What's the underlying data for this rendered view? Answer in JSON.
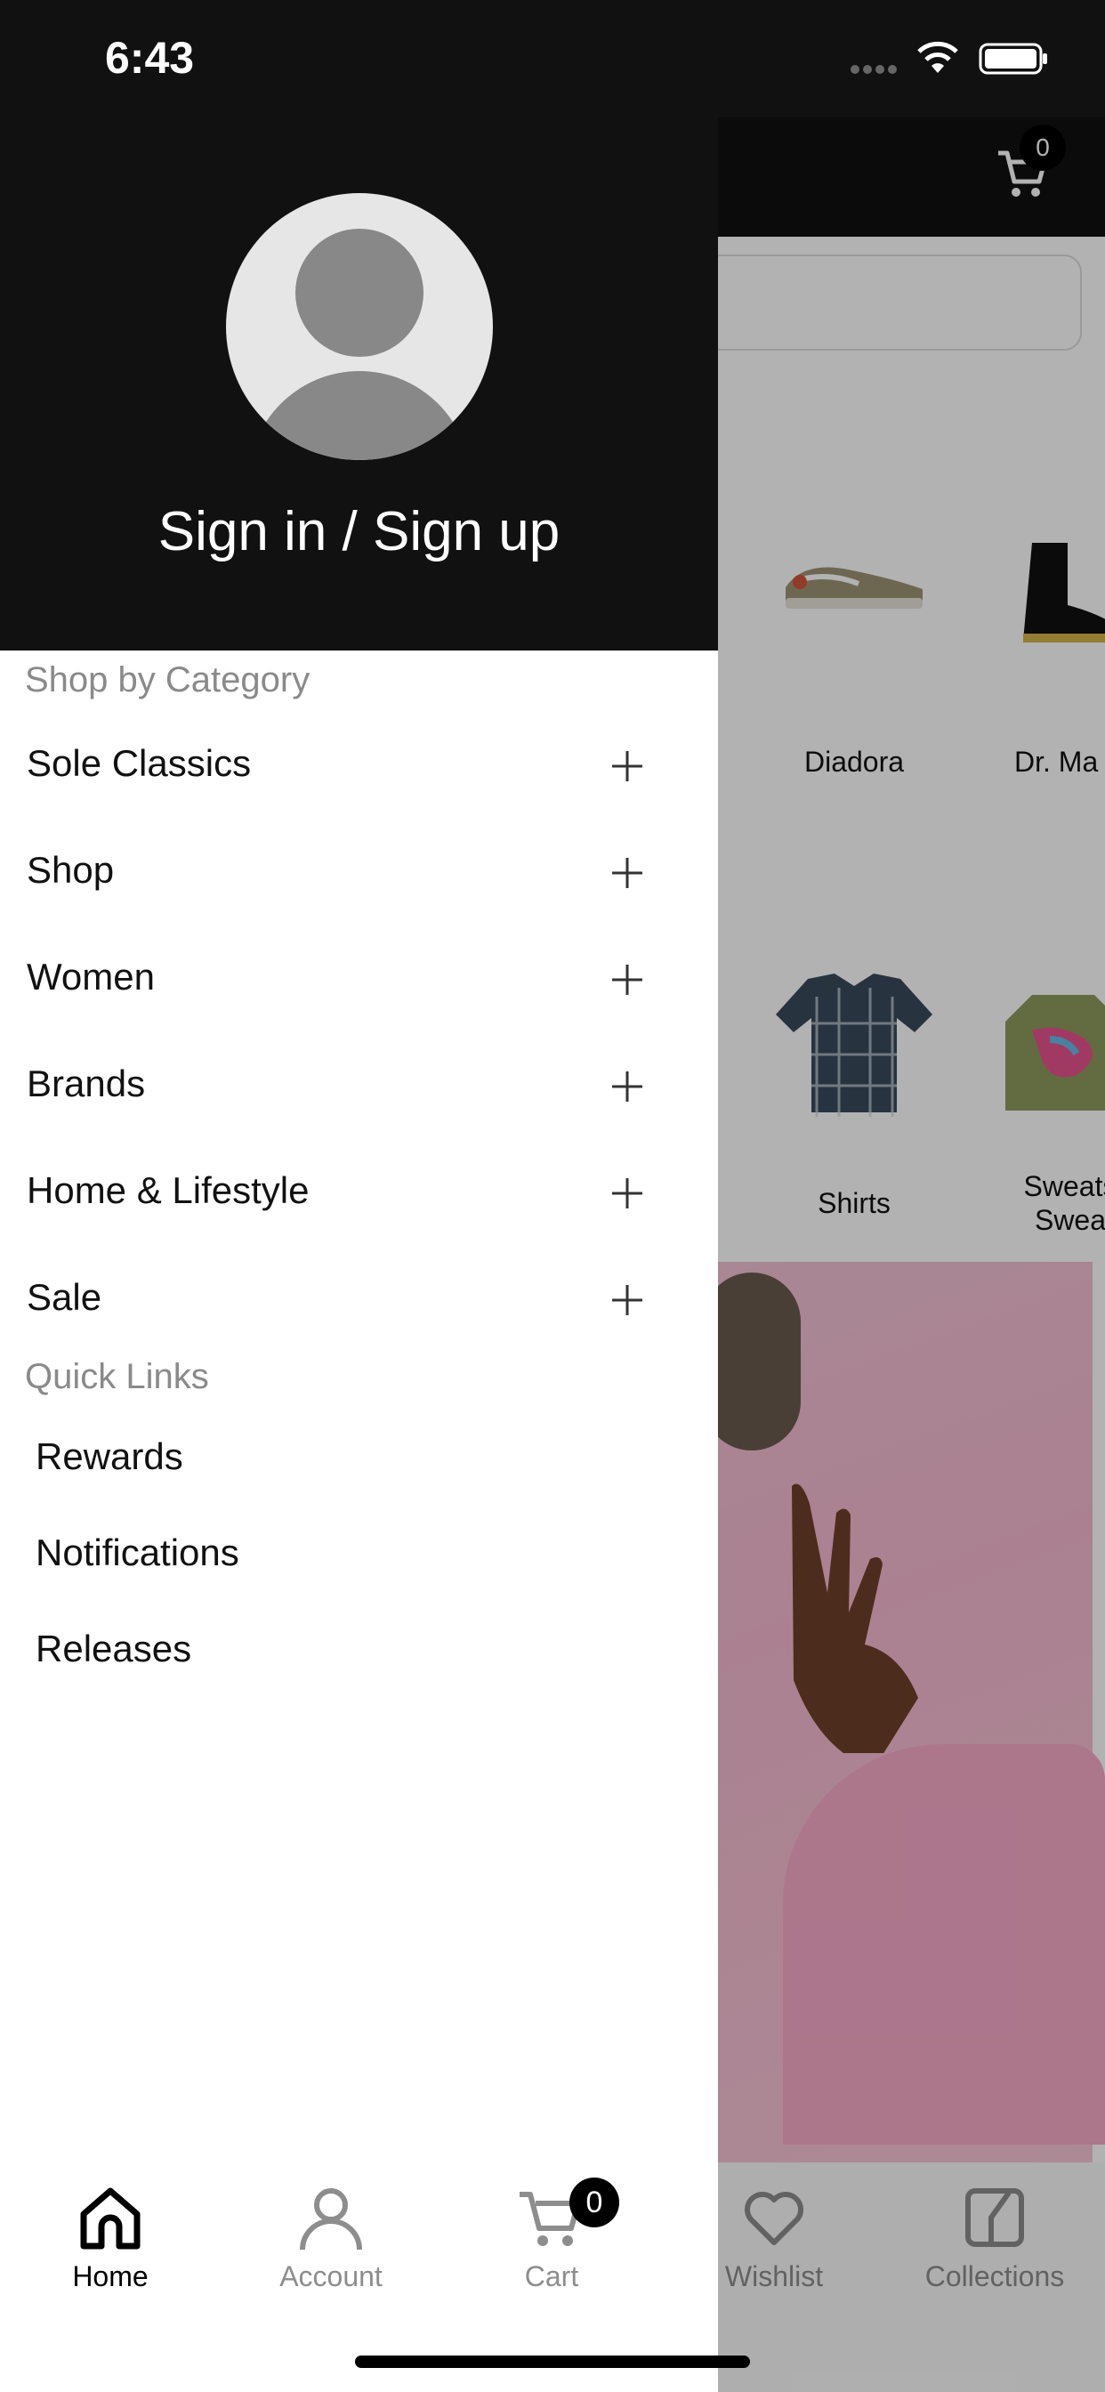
{
  "status_bar": {
    "time": "6:43"
  },
  "background_app": {
    "cart_badge": "0",
    "brands": [
      {
        "label": "Diadora"
      },
      {
        "label": "Dr. Ma"
      }
    ],
    "categories": [
      {
        "label": "Shirts"
      },
      {
        "label": "Sweats Swea"
      }
    ]
  },
  "drawer": {
    "sign_in_label": "Sign in / Sign up",
    "shop_by_category": {
      "title": "Shop by Category",
      "items": [
        {
          "label": "Sole Classics"
        },
        {
          "label": "Shop"
        },
        {
          "label": "Women"
        },
        {
          "label": "Brands"
        },
        {
          "label": "Home & Lifestyle"
        },
        {
          "label": "Sale"
        }
      ]
    },
    "quick_links": {
      "title": "Quick Links",
      "items": [
        {
          "label": "Rewards"
        },
        {
          "label": "Notifications"
        },
        {
          "label": "Releases"
        }
      ]
    }
  },
  "tab_bar": {
    "items": [
      {
        "label": "Home",
        "icon": "home-icon",
        "active": true
      },
      {
        "label": "Account",
        "icon": "account-icon"
      },
      {
        "label": "Cart",
        "icon": "cart-icon",
        "badge": "0"
      },
      {
        "label": "Wishlist",
        "icon": "heart-icon"
      },
      {
        "label": "Collections",
        "icon": "collections-icon"
      }
    ]
  },
  "colors": {
    "header_bg": "#111111",
    "active_tab": "#000000",
    "inactive_tab": "#8d8d8d",
    "section_title": "#8a8a8a"
  }
}
